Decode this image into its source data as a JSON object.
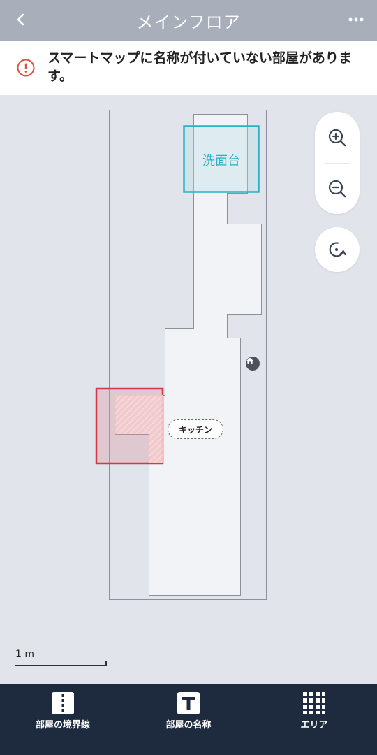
{
  "header": {
    "title": "メインフロア",
    "back_icon": "chevron-left-icon",
    "more_icon": "more-dots-icon"
  },
  "warning": {
    "icon": "alert-circle-icon",
    "text": "スマートマップに名称が付いていない部屋があります。",
    "color": "#e2503c"
  },
  "map": {
    "rooms": [
      {
        "name": "洗面台",
        "color": "#29b2c4"
      },
      {
        "name": "キッチン",
        "color": "#ffffff"
      }
    ],
    "no_go_zone_color": "#d03a48",
    "dock_icon": "home-icon",
    "scale_label": "1 m"
  },
  "controls": {
    "zoom_in_icon": "zoom-in-icon",
    "zoom_out_icon": "zoom-out-icon",
    "rotate_icon": "rotate-icon"
  },
  "bottom_nav": {
    "items": [
      {
        "label": "部屋の境界線",
        "icon": "room-divider-icon"
      },
      {
        "label": "部屋の名称",
        "icon": "text-t-icon"
      },
      {
        "label": "エリア",
        "icon": "grid-area-icon"
      }
    ]
  }
}
